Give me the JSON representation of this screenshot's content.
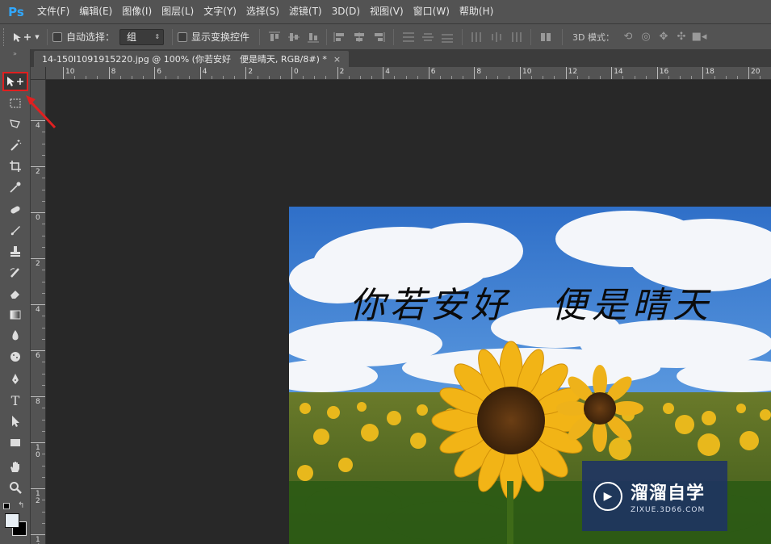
{
  "app": {
    "logo": "Ps"
  },
  "menu": [
    "文件(F)",
    "编辑(E)",
    "图像(I)",
    "图层(L)",
    "文字(Y)",
    "选择(S)",
    "滤镜(T)",
    "3D(D)",
    "视图(V)",
    "窗口(W)",
    "帮助(H)"
  ],
  "options": {
    "auto_select_label": "自动选择：",
    "auto_select_value": "组",
    "show_transform_label": "显示变换控件",
    "mode3d_label": "3D 模式："
  },
  "document": {
    "tab_title": "14-150I1091915220.jpg @ 100% (你若安好　便是晴天, RGB/8#) *",
    "close": "×"
  },
  "ruler_top": [
    "10",
    "8",
    "6",
    "4",
    "2",
    "0",
    "2",
    "4",
    "6",
    "8",
    "10",
    "12",
    "14",
    "16",
    "18",
    "20"
  ],
  "ruler_left": [
    "4",
    "2",
    "0",
    "2",
    "4",
    "6",
    "8",
    "1 0",
    "1 2",
    "1 4"
  ],
  "image": {
    "caption": "你若安好　便是晴天",
    "watermark_title": "溜溜自学",
    "watermark_sub": "ZIXUE.3D66.COM"
  },
  "toolbar": {
    "head": "»",
    "tools": [
      "move-tool",
      "marquee-tool",
      "lasso-tool",
      "magic-wand-tool",
      "crop-tool",
      "eyedropper-tool",
      "healing-brush-tool",
      "brush-tool",
      "clone-stamp-tool",
      "history-brush-tool",
      "eraser-tool",
      "gradient-tool",
      "blur-tool",
      "dodge-tool",
      "pen-tool",
      "type-tool",
      "path-selection-tool",
      "rectangle-tool",
      "hand-tool",
      "zoom-tool"
    ]
  },
  "colors": {
    "accent_red": "#e02020",
    "ps_blue": "#31a8ff",
    "fg": "#e7eef4",
    "bg": "#000000"
  }
}
